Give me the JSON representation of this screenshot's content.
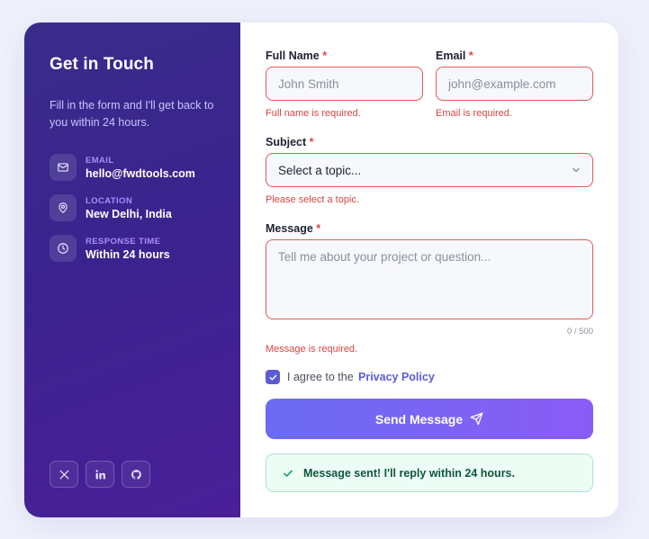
{
  "sidebar": {
    "title": "Get in Touch",
    "subtitle": "Fill in the form and I'll get back to you within 24 hours.",
    "info": [
      {
        "label": "EMAIL",
        "value": "hello@fwdtools.com",
        "icon": "mail-icon"
      },
      {
        "label": "LOCATION",
        "value": "New Delhi, India",
        "icon": "map-pin-icon"
      },
      {
        "label": "RESPONSE TIME",
        "value": "Within 24 hours",
        "icon": "clock-icon"
      }
    ],
    "socials": [
      "x-icon",
      "linkedin-icon",
      "github-icon"
    ]
  },
  "form": {
    "full_name": {
      "label": "Full Name",
      "required_mark": "*",
      "placeholder": "John Smith",
      "value": "",
      "error": "Full name is required."
    },
    "email": {
      "label": "Email",
      "required_mark": "*",
      "placeholder": "john@example.com",
      "value": "",
      "error": "Email is required."
    },
    "subject": {
      "label": "Subject",
      "required_mark": "*",
      "selected": "Select a topic...",
      "error": "Please select a topic."
    },
    "message": {
      "label": "Message",
      "required_mark": "*",
      "placeholder": "Tell me about your project or question...",
      "value": "",
      "counter": "0 / 500",
      "error": "Message is required."
    },
    "agree": {
      "text": "I agree to the",
      "link": "Privacy Policy",
      "checked": true
    },
    "submit_label": "Send Message"
  },
  "toast": {
    "text": "Message sent! I'll reply within 24 hours."
  },
  "colors": {
    "accent": "#5b5bd6",
    "error": "#d94444",
    "success": "#11553c",
    "sidebar": "#3a238e"
  }
}
